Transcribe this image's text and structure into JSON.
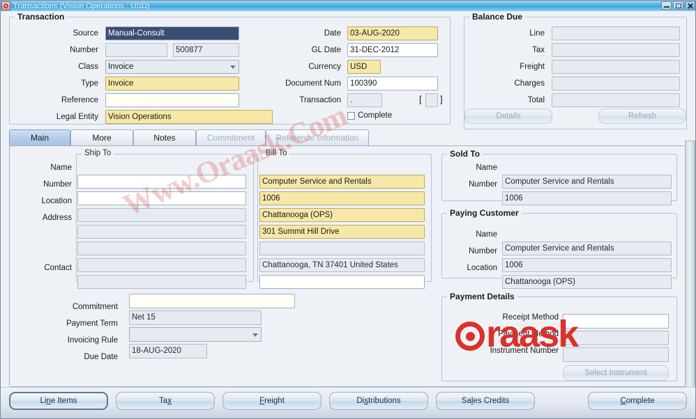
{
  "window": {
    "title": "Transactions (Vision Operations : USD)",
    "app_icon": "oracle-forms-icon",
    "controls": {
      "minimize": "minimize-icon",
      "maximize": "maximize-icon",
      "close": "close-icon"
    }
  },
  "transaction": {
    "group_title": "Transaction",
    "fields": {
      "source_label": "Source",
      "source_value": "Manual-Consult",
      "number_label": "Number",
      "number_value": "",
      "number_value2": "500877",
      "class_label": "Class",
      "class_value": "Invoice",
      "type_label": "Type",
      "type_value": "Invoice",
      "reference_label": "Reference",
      "reference_value": "",
      "legal_entity_label": "Legal Entity",
      "legal_entity_value": "Vision Operations",
      "date_label": "Date",
      "date_value": "03-AUG-2020",
      "gl_date_label": "GL Date",
      "gl_date_value": "31-DEC-2012",
      "currency_label": "Currency",
      "currency_value": "USD",
      "document_num_label": "Document Num",
      "document_num_value": "100390",
      "transaction_label": "Transaction",
      "transaction_value": ".",
      "transaction_flex_value": "",
      "complete_label": "Complete",
      "complete_checked": false
    }
  },
  "balance_due": {
    "group_title": "Balance Due",
    "rows": [
      {
        "label": "Line",
        "value": ""
      },
      {
        "label": "Tax",
        "value": ""
      },
      {
        "label": "Freight",
        "value": ""
      },
      {
        "label": "Charges",
        "value": ""
      },
      {
        "label": "Total",
        "value": ""
      }
    ],
    "details_button": "Details",
    "refresh_button": "Refresh"
  },
  "tabs": [
    {
      "label": "Main",
      "state": "active"
    },
    {
      "label": "More",
      "state": "enabled"
    },
    {
      "label": "Notes",
      "state": "enabled"
    },
    {
      "label": "Commitment",
      "state": "disabled"
    },
    {
      "label": "Reference Information",
      "state": "disabled"
    }
  ],
  "ship_to": {
    "group_title": "Ship To",
    "name_label": "Name",
    "name_value": "",
    "number_label": "Number",
    "number_value": "",
    "location_label": "Location",
    "location_value": "",
    "address_label": "Address",
    "address_value": "",
    "address_line2_value": "",
    "address_line3_value": "",
    "contact_label": "Contact",
    "contact_value": ""
  },
  "bill_to": {
    "group_title": "Bill To",
    "name_value": "Computer Service and Rentals",
    "number_value": "1006",
    "location_value": "Chattanooga (OPS)",
    "address_value": "301 Summit Hill Drive",
    "address_line2_value": "",
    "address_line3_value": "Chattanooga, TN 37401 United States",
    "contact_value": ""
  },
  "sold_to": {
    "group_title": "Sold To",
    "name_label": "Name",
    "name_value": "Computer Service and Rentals",
    "number_label": "Number",
    "number_value": "1006"
  },
  "paying_customer": {
    "group_title": "Paying Customer",
    "name_label": "Name",
    "name_value": "Computer Service and Rentals",
    "number_label": "Number",
    "number_value": "1006",
    "location_label": "Location",
    "location_value": "Chattanooga (OPS)"
  },
  "terms": {
    "commitment_label": "Commitment",
    "commitment_value": "",
    "payment_term_label": "Payment Term",
    "payment_term_value": "Net 15",
    "invoicing_rule_label": "Invoicing Rule",
    "invoicing_rule_value": "",
    "due_date_label": "Due Date",
    "due_date_value": "18-AUG-2020"
  },
  "payment_details": {
    "group_title": "Payment Details",
    "receipt_method_label": "Receipt Method",
    "receipt_method_value": "",
    "payment_method_label": "Payment Method",
    "payment_method_value": "",
    "instrument_number_label": "Instrument Number",
    "instrument_number_value": "",
    "select_instrument_button": "Select Instrument"
  },
  "toolbar_buttons": [
    {
      "label": "Line Items",
      "mnemonic_index": 2
    },
    {
      "label": "Tax",
      "mnemonic_index": 2
    },
    {
      "label": "Freight",
      "mnemonic_index": 0
    },
    {
      "label": "Distributions",
      "mnemonic_index": 2
    },
    {
      "label": "Sales Credits",
      "mnemonic_index": 2
    },
    {
      "label": "Complete",
      "mnemonic_index": 0
    }
  ],
  "watermarks": {
    "url": "Www.Oraask.Com",
    "logo": "raask"
  },
  "colors": {
    "required_field": "#f6e9a7",
    "titlebar": "#3aa7df",
    "active_tab": "#b4cbe7",
    "logo_red": "#d8322a",
    "canvas": "#eef1f6"
  }
}
